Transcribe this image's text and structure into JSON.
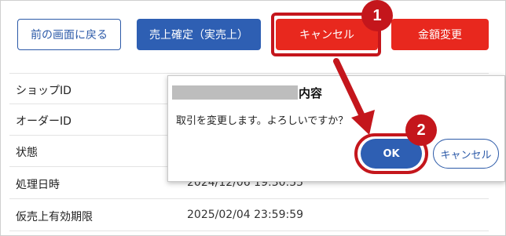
{
  "toolbar": {
    "back_label": "前の画面に戻る",
    "confirm_sale_label": "売上確定（実売上）",
    "cancel_label": "キャンセル",
    "amount_change_label": "金額変更"
  },
  "details": {
    "rows": [
      {
        "label": "ショップID",
        "value": ""
      },
      {
        "label": "オーダーID",
        "value": ""
      },
      {
        "label": "状態",
        "value": ""
      },
      {
        "label": "処理日時",
        "value": "2024/12/06 19:30:55"
      },
      {
        "label": "仮売上有効期限",
        "value": "2025/02/04 23:59:59"
      }
    ]
  },
  "dialog": {
    "title_suffix": "内容",
    "message": "取引を変更します。よろしいですか？",
    "ok_label": "OK",
    "cancel_label": "キャンセル"
  },
  "steps": [
    "1",
    "2"
  ],
  "colors": {
    "primary": "#2e5fb3",
    "danger": "#e8281e",
    "highlight": "#c4161c"
  }
}
